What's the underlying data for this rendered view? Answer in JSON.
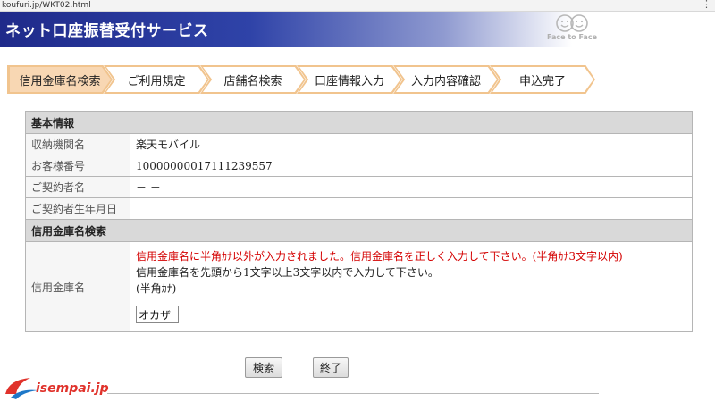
{
  "browser": {
    "url": "koufuri.jp/WKT02.html",
    "menu_icon": "more-vertical-icon"
  },
  "header": {
    "title": "ネット口座振替受付サービス",
    "logo_text": "Face to Face"
  },
  "steps": [
    {
      "label": "信用金庫名検索",
      "active": true
    },
    {
      "label": "ご利用規定",
      "active": false
    },
    {
      "label": "店舗名検索",
      "active": false
    },
    {
      "label": "口座情報入力",
      "active": false
    },
    {
      "label": "入力内容確認",
      "active": false
    },
    {
      "label": "申込完了",
      "active": false
    }
  ],
  "basic_info": {
    "heading": "基本情報",
    "rows": [
      {
        "label": "収納機関名",
        "value": "楽天モバイル"
      },
      {
        "label": "お客様番号",
        "value": "10000000017111239557"
      },
      {
        "label": "ご契約者名",
        "value": "－ －"
      },
      {
        "label": "ご契約者生年月日",
        "value": ""
      }
    ]
  },
  "search": {
    "heading": "信用金庫名検索",
    "label": "信用金庫名",
    "error": "信用金庫名に半角ｶﾅ以外が入力されました。信用金庫名を正しく入力して下さい。(半角ｶﾅ3文字以内)",
    "help": "信用金庫名を先頭から1文字以上3文字以内で入力して下さい。",
    "note": "(半角ｶﾅ)",
    "input_value": "オカザ"
  },
  "buttons": {
    "search": "検索",
    "end": "終了"
  },
  "watermark": "isempai.jp",
  "colors": {
    "header_dark": "#1f2a8a",
    "step_border": "#f1c48e",
    "step_active": "#f8d7b3",
    "error": "#d40000",
    "section_bg": "#d9d9d9"
  }
}
